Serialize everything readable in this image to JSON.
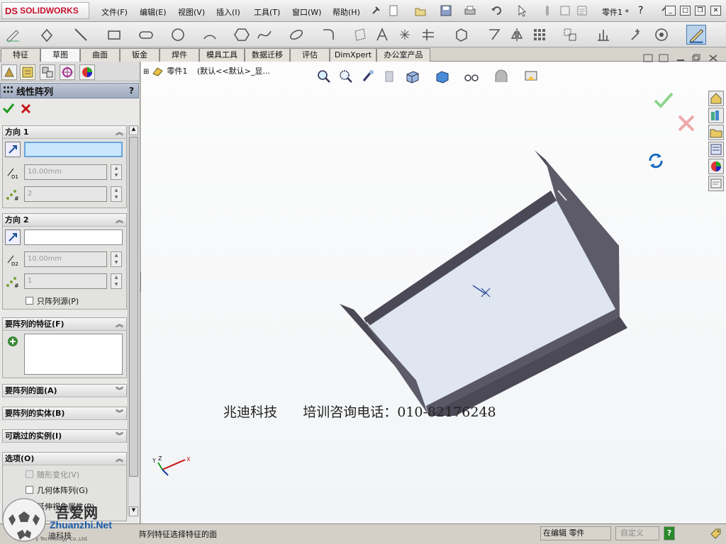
{
  "app": {
    "logo_ds": "DS",
    "logo_name": "SOLIDWORKS",
    "doc_title": "零件1 *",
    "help": "?"
  },
  "menu": {
    "items": [
      "文件(F)",
      "编辑(E)",
      "视图(V)",
      "插入(I)",
      "工具(T)",
      "窗口(W)",
      "帮助(H)"
    ]
  },
  "tabs": [
    "特征",
    "草图",
    "曲面",
    "钣金",
    "焊件",
    "模具工具",
    "数据迁移",
    "评估",
    "DimXpert",
    "办公室产品"
  ],
  "active_tab": "草图",
  "property_manager": {
    "title": "线性阵列",
    "help": "?",
    "direction1": {
      "header": "方向 1",
      "spacing": "10.00mm",
      "count": "2"
    },
    "direction2": {
      "header": "方向 2",
      "spacing": "10.00mm",
      "count": "1",
      "pattern_seed_only": "只阵列源(P)"
    },
    "features_to_pattern": {
      "header": "要阵列的特征(F)"
    },
    "faces_to_pattern": {
      "header": "要阵列的面(A)"
    },
    "bodies_to_pattern": {
      "header": "要阵列的实体(B)"
    },
    "instances_to_skip": {
      "header": "可跳过的实例(I)"
    },
    "options": {
      "header": "选项(O)",
      "vary_sketch": "随形变化(V)",
      "geometry_pattern": "几何体阵列(G)",
      "propagate_visual": "延伸视象属性(P)"
    }
  },
  "viewport": {
    "tree_root": "零件1",
    "tree_config": "(默认<<默认>_显...",
    "watermark": "兆迪科技      培训咨询电话：010-82176248",
    "triad": {
      "x": "X",
      "y": "Y",
      "z": "Z"
    }
  },
  "status": {
    "message": "阵列特征选择特征的面",
    "editing": "在编辑 零件",
    "custom": "自定义",
    "help": "?"
  },
  "badge": {
    "site_cn": "吾爱网",
    "site_en": "Zhuanzhi.Net",
    "company": "迪科技",
    "company_en": "y Technology Co.,Ltd."
  },
  "colors": {
    "accept": "#1f9a1f",
    "cancel": "#c81414",
    "flange": "#4b4956",
    "plate": "#dfe6f0",
    "pm_title": "#9eaac0"
  }
}
